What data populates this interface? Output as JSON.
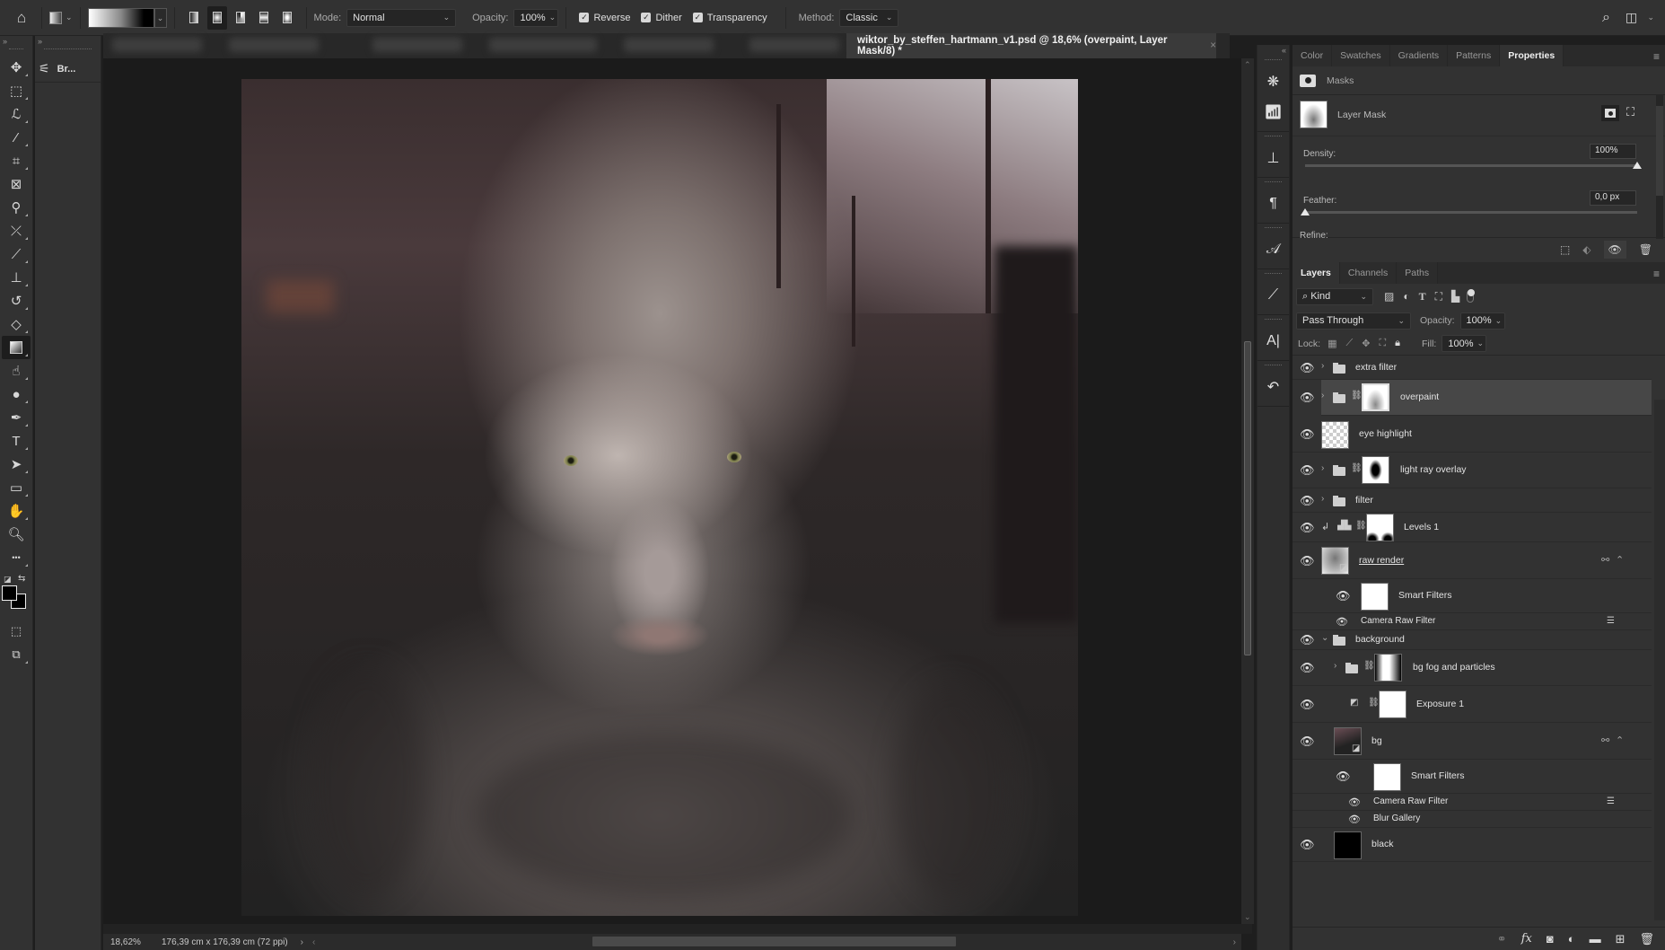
{
  "options_bar": {
    "home_icon": "home-icon",
    "tool_preset_icon": "gradient-tool-preset-icon",
    "gradient_shapes": [
      "linear-gradient",
      "radial-gradient",
      "angle-gradient",
      "reflected-gradient",
      "diamond-gradient"
    ],
    "selected_shape": "radial-gradient",
    "mode_label": "Mode:",
    "mode_value": "Normal",
    "opacity_label": "Opacity:",
    "opacity_value": "100%",
    "reverse_label": "Reverse",
    "reverse_checked": true,
    "dither_label": "Dither",
    "dither_checked": true,
    "transparency_label": "Transparency",
    "transparency_checked": true,
    "method_label": "Method:",
    "method_value": "Classic",
    "search_icon": "search-icon",
    "workspace_icon": "workspace-icon"
  },
  "toolbar": {
    "collapse": "»",
    "tools": [
      {
        "name": "move-tool",
        "glyph": "✥"
      },
      {
        "name": "marquee-tool",
        "glyph": "⬚"
      },
      {
        "name": "lasso-tool",
        "glyph": "ℒ"
      },
      {
        "name": "magic-wand-tool",
        "glyph": "⁄"
      },
      {
        "name": "crop-tool",
        "glyph": "⌗"
      },
      {
        "name": "frame-tool",
        "glyph": "⊠"
      },
      {
        "name": "eyedropper-tool",
        "glyph": "⚲"
      },
      {
        "name": "healing-brush-tool",
        "glyph": "⤫"
      },
      {
        "name": "brush-tool",
        "glyph": "⟋"
      },
      {
        "name": "clone-stamp-tool",
        "glyph": "⊥"
      },
      {
        "name": "history-brush-tool",
        "glyph": "↺"
      },
      {
        "name": "eraser-tool",
        "glyph": "◇"
      },
      {
        "name": "gradient-tool",
        "glyph": "▣",
        "selected": true
      },
      {
        "name": "smudge-tool",
        "glyph": "☝"
      },
      {
        "name": "dodge-tool",
        "glyph": "●"
      },
      {
        "name": "pen-tool",
        "glyph": "✒"
      },
      {
        "name": "type-tool",
        "glyph": "T"
      },
      {
        "name": "path-selection-tool",
        "glyph": "➤"
      },
      {
        "name": "rectangle-tool",
        "glyph": "▭"
      },
      {
        "name": "hand-tool",
        "glyph": "✋"
      },
      {
        "name": "zoom-tool",
        "glyph": "🔍︎"
      },
      {
        "name": "edit-toolbar",
        "glyph": "•••"
      }
    ],
    "foreground_color": "#000000",
    "background_color": "#000000"
  },
  "brush_panel": {
    "label": "Br..."
  },
  "document": {
    "tab_title": "wiktor_by_steffen_hartmann_v1.psd @ 18,6% (overpaint, Layer Mask/8) *",
    "close": "×",
    "zoom": "18,62%",
    "doc_info": "176,39 cm x 176,39 cm (72 ppi)",
    "status_more": "›",
    "status_back": "‹"
  },
  "icon_strip": [
    {
      "name": "adjustments-icon",
      "glyph": "❋"
    },
    {
      "name": "histogram-icon",
      "glyph": "📶︎"
    },
    {
      "name": "clone-source-icon",
      "glyph": "⊥"
    },
    {
      "name": "paragraph-icon",
      "glyph": "¶"
    },
    {
      "name": "glyphs-icon",
      "glyph": "𝒜"
    },
    {
      "name": "brush-settings-icon",
      "glyph": "⟋"
    },
    {
      "name": "character-icon",
      "glyph": "A|"
    },
    {
      "name": "history-icon",
      "glyph": "↶"
    }
  ],
  "properties_panel": {
    "tabs": [
      "Color",
      "Swatches",
      "Gradients",
      "Patterns",
      "Properties"
    ],
    "active_tab": "Properties",
    "section_title": "Masks",
    "mask_name": "Layer Mask",
    "density_label": "Density:",
    "density_value": "100%",
    "density_fraction": 1.0,
    "feather_label": "Feather:",
    "feather_value": "0,0 px",
    "feather_fraction": 0.0,
    "refine_label": "Refine:"
  },
  "layers_panel": {
    "tabs": [
      "Layers",
      "Channels",
      "Paths"
    ],
    "active_tab": "Layers",
    "filter_kind": "Kind",
    "blend_mode": "Pass Through",
    "opacity_label": "Opacity:",
    "opacity_value": "100%",
    "lock_label": "Lock:",
    "fill_label": "Fill:",
    "fill_value": "100%",
    "layers": [
      {
        "name": "extra filter",
        "type": "group",
        "indent": 0,
        "visible": true
      },
      {
        "name": "overpaint",
        "type": "group-mask",
        "indent": 0,
        "visible": true,
        "selected": true
      },
      {
        "name": "eye highlight",
        "type": "pixel-transparent",
        "indent": 0,
        "visible": true
      },
      {
        "name": "light ray overlay",
        "type": "group-mask",
        "indent": 0,
        "visible": true
      },
      {
        "name": "filter",
        "type": "group",
        "indent": 0,
        "visible": true
      },
      {
        "name": "Levels 1",
        "type": "adjustment-levels",
        "indent": 0,
        "visible": true,
        "clipped": true
      },
      {
        "name": "raw render",
        "type": "smart-object",
        "indent": 0,
        "visible": true
      },
      {
        "name": "Smart Filters",
        "type": "smart-filters",
        "indent": 1,
        "visible": true
      },
      {
        "name": "Camera Raw Filter",
        "type": "filter",
        "indent": 2,
        "visible": true
      },
      {
        "name": "background",
        "type": "group-open",
        "indent": 0,
        "visible": true
      },
      {
        "name": "bg fog and particles",
        "type": "group-mask",
        "indent": 1,
        "visible": true
      },
      {
        "name": "Exposure 1",
        "type": "adjustment-exposure",
        "indent": 1,
        "visible": true
      },
      {
        "name": "bg",
        "type": "smart-object",
        "indent": 1,
        "visible": true
      },
      {
        "name": "Smart Filters",
        "type": "smart-filters",
        "indent": 2,
        "visible": true
      },
      {
        "name": "Camera Raw Filter",
        "type": "filter",
        "indent": 3,
        "visible": true
      },
      {
        "name": "Blur Gallery",
        "type": "filter",
        "indent": 3,
        "visible": true
      },
      {
        "name": "black",
        "type": "pixel-black",
        "indent": 1,
        "visible": true
      }
    ],
    "bottom_actions": [
      "link-layers-icon",
      "fx-icon",
      "add-mask-icon",
      "adjustment-layer-icon",
      "new-group-icon",
      "new-layer-icon",
      "delete-icon"
    ]
  }
}
